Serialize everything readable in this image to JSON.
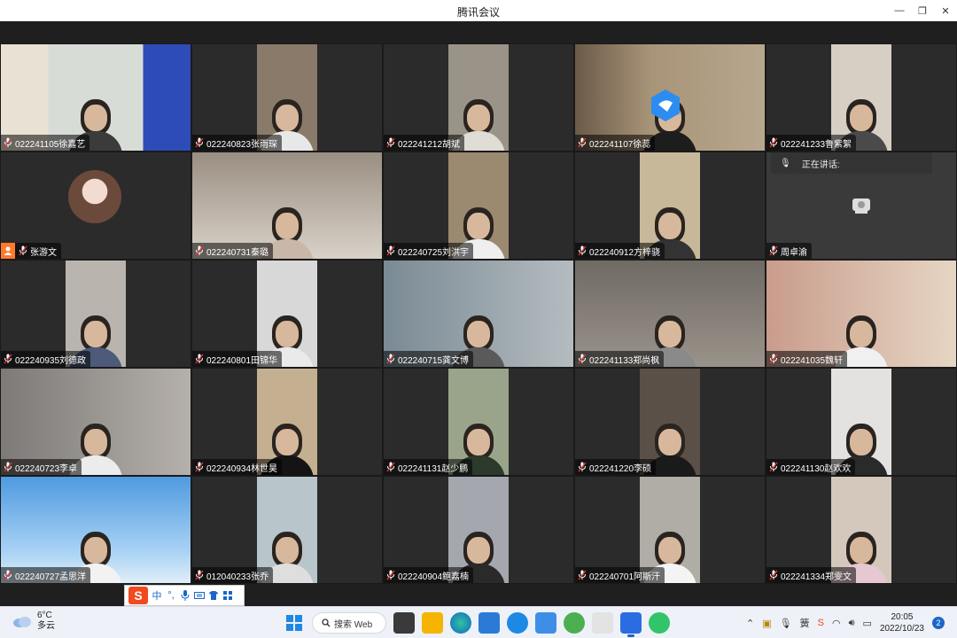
{
  "window": {
    "title": "腾讯会议",
    "minimize": "—",
    "maximize": "❐",
    "close": "✕"
  },
  "speaking": {
    "label": "正在讲话:"
  },
  "participants": [
    {
      "name": "022241105徐嘉艺"
    },
    {
      "name": "022240823张雨琛"
    },
    {
      "name": "022241212胡斌"
    },
    {
      "name": "022241107徐蕊"
    },
    {
      "name": "022241233鲁紫絮"
    },
    {
      "name": "张游文"
    },
    {
      "name": "022240731秦璐"
    },
    {
      "name": "022240725刘洪宇"
    },
    {
      "name": "022240912方梓骁"
    },
    {
      "name": "周卓渝"
    },
    {
      "name": "022240935刘德政"
    },
    {
      "name": "022240801田锦华"
    },
    {
      "name": "022240715龚文博"
    },
    {
      "name": "022241133郑尚枫"
    },
    {
      "name": "022241035魏轩"
    },
    {
      "name": "022240723李卓"
    },
    {
      "name": "022240934林世昊"
    },
    {
      "name": "022241131赵少鹏"
    },
    {
      "name": "022241220李硕"
    },
    {
      "name": "022241130赵欢欢"
    },
    {
      "name": "022240727孟思洋"
    },
    {
      "name": "012040233张乔"
    },
    {
      "name": "022240904鲍嘉楠"
    },
    {
      "name": "022240701阿斯汗"
    },
    {
      "name": "022241334郑雯文"
    }
  ],
  "ime": {
    "logo": "S",
    "mode": "中",
    "punct": "°,"
  },
  "taskbar": {
    "weather_temp": "6°C",
    "weather_desc": "多云",
    "search_label": "搜索 Web",
    "time": "20:05",
    "date": "2022/10/23",
    "notifications": "2",
    "tray_lang": "簧"
  },
  "colors": {
    "host_badge": "#ff7a2a",
    "accent": "#1a66c8"
  }
}
